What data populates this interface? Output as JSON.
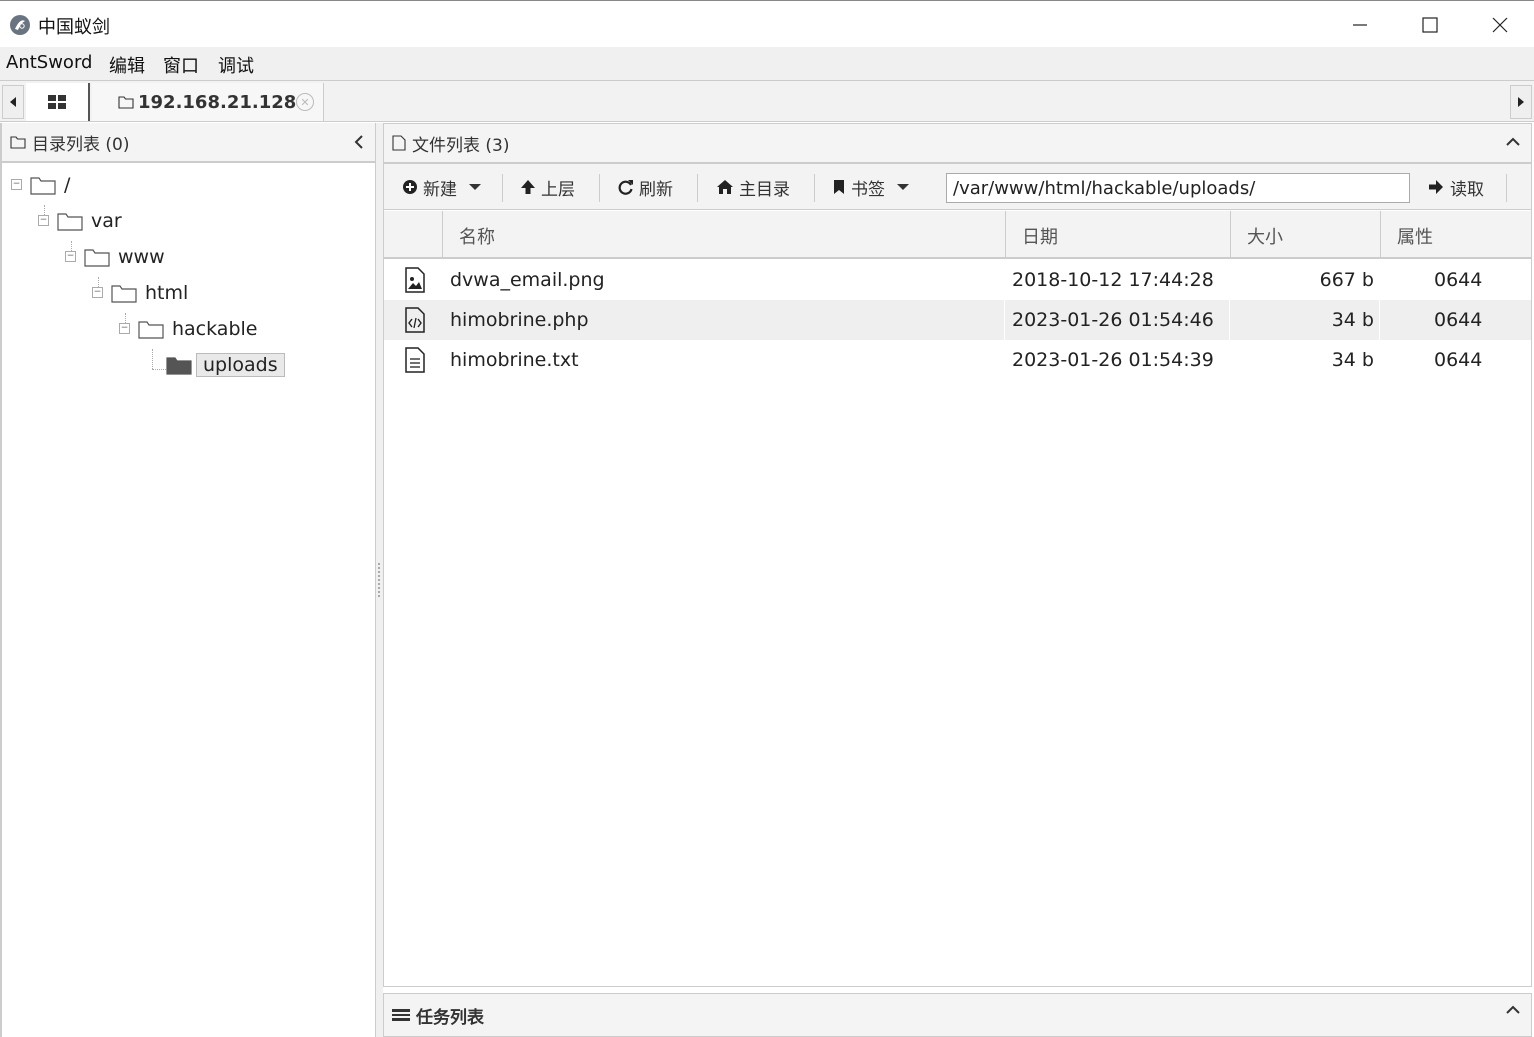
{
  "window": {
    "title": "中国蚁剑"
  },
  "menu": [
    "AntSword",
    "编辑",
    "窗口",
    "调试"
  ],
  "tabs": {
    "shell_label": "192.168.21.128"
  },
  "left_panel": {
    "title": "目录列表 (0)",
    "tree": [
      {
        "name": "/",
        "depth": 0
      },
      {
        "name": "var",
        "depth": 1
      },
      {
        "name": "www",
        "depth": 2
      },
      {
        "name": "html",
        "depth": 3
      },
      {
        "name": "hackable",
        "depth": 4
      },
      {
        "name": "uploads",
        "depth": 5,
        "selected": true
      }
    ]
  },
  "right_panel": {
    "title": "文件列表 (3)",
    "toolbar": {
      "new_label": "新建",
      "up_label": "上层",
      "refresh_label": "刷新",
      "home_label": "主目录",
      "bookmark_label": "书签",
      "path": "/var/www/html/hackable/uploads/",
      "read_label": "读取"
    },
    "columns": [
      "名称",
      "日期",
      "大小",
      "属性"
    ],
    "files": [
      {
        "icon": "image-file-icon",
        "name": "dvwa_email.png",
        "date": "2018-10-12 17:44:28",
        "size": "667 b",
        "attr": "0644"
      },
      {
        "icon": "code-file-icon",
        "name": "himobrine.php",
        "date": "2023-01-26 01:54:46",
        "size": "34 b",
        "attr": "0644"
      },
      {
        "icon": "text-file-icon",
        "name": "himobrine.txt",
        "date": "2023-01-26 01:54:39",
        "size": "34 b",
        "attr": "0644"
      }
    ]
  },
  "task_panel": {
    "title": "任务列表"
  },
  "colors": {
    "selected_row": "#efefef",
    "panel_header": "#f4f4f4",
    "border": "#cccccc"
  }
}
